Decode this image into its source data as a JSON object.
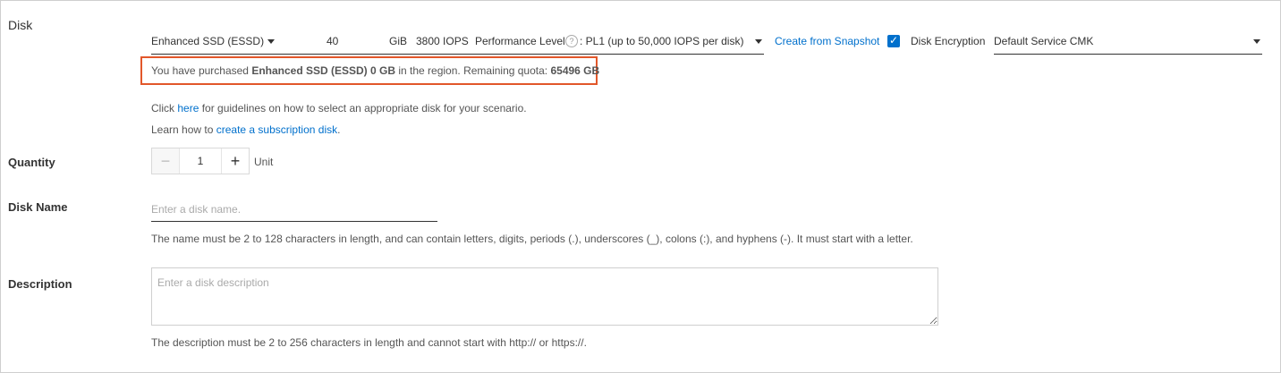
{
  "section": {
    "title": "Disk"
  },
  "disk": {
    "category": "Enhanced SSD (ESSD)",
    "size": "40",
    "size_unit": "GiB",
    "iops": "3800 IOPS",
    "performance_label": "Performance Level",
    "performance_value": ": PL1 (up to 50,000 IOPS per disk)",
    "snapshot_link": "Create from Snapshot",
    "encryption_checked": true,
    "encryption_label": "Disk Encryption",
    "cmk_value": "Default Service CMK"
  },
  "quota": {
    "prefix": "You have purchased ",
    "bold_disk": "Enhanced SSD (ESSD) 0 GB",
    "middle": " in the region. Remaining quota: ",
    "bold_quota": "65496 GB"
  },
  "guide": {
    "line1_prefix": "Click ",
    "line1_link": "here",
    "line1_suffix": " for guidelines on how to select an appropriate disk for your scenario.",
    "line2_prefix": "Learn how to ",
    "line2_link": "create a subscription disk",
    "line2_suffix": "."
  },
  "quantity": {
    "label": "Quantity",
    "value": "1",
    "unit": "Unit",
    "minus": "−",
    "plus": "+"
  },
  "disk_name": {
    "label": "Disk Name",
    "placeholder": "Enter a disk name.",
    "hint": "The name must be 2 to 128 characters in length, and can contain letters, digits, periods (.), underscores (_), colons (:), and hyphens (-). It must start with a letter."
  },
  "description": {
    "label": "Description",
    "placeholder": "Enter a disk description",
    "hint": "The description must be 2 to 256 characters in length and cannot start with http:// or https://."
  },
  "icons": {
    "help": "?",
    "check": "✓"
  },
  "colors": {
    "accent": "#0070cc",
    "highlight_border": "#e2572a"
  }
}
